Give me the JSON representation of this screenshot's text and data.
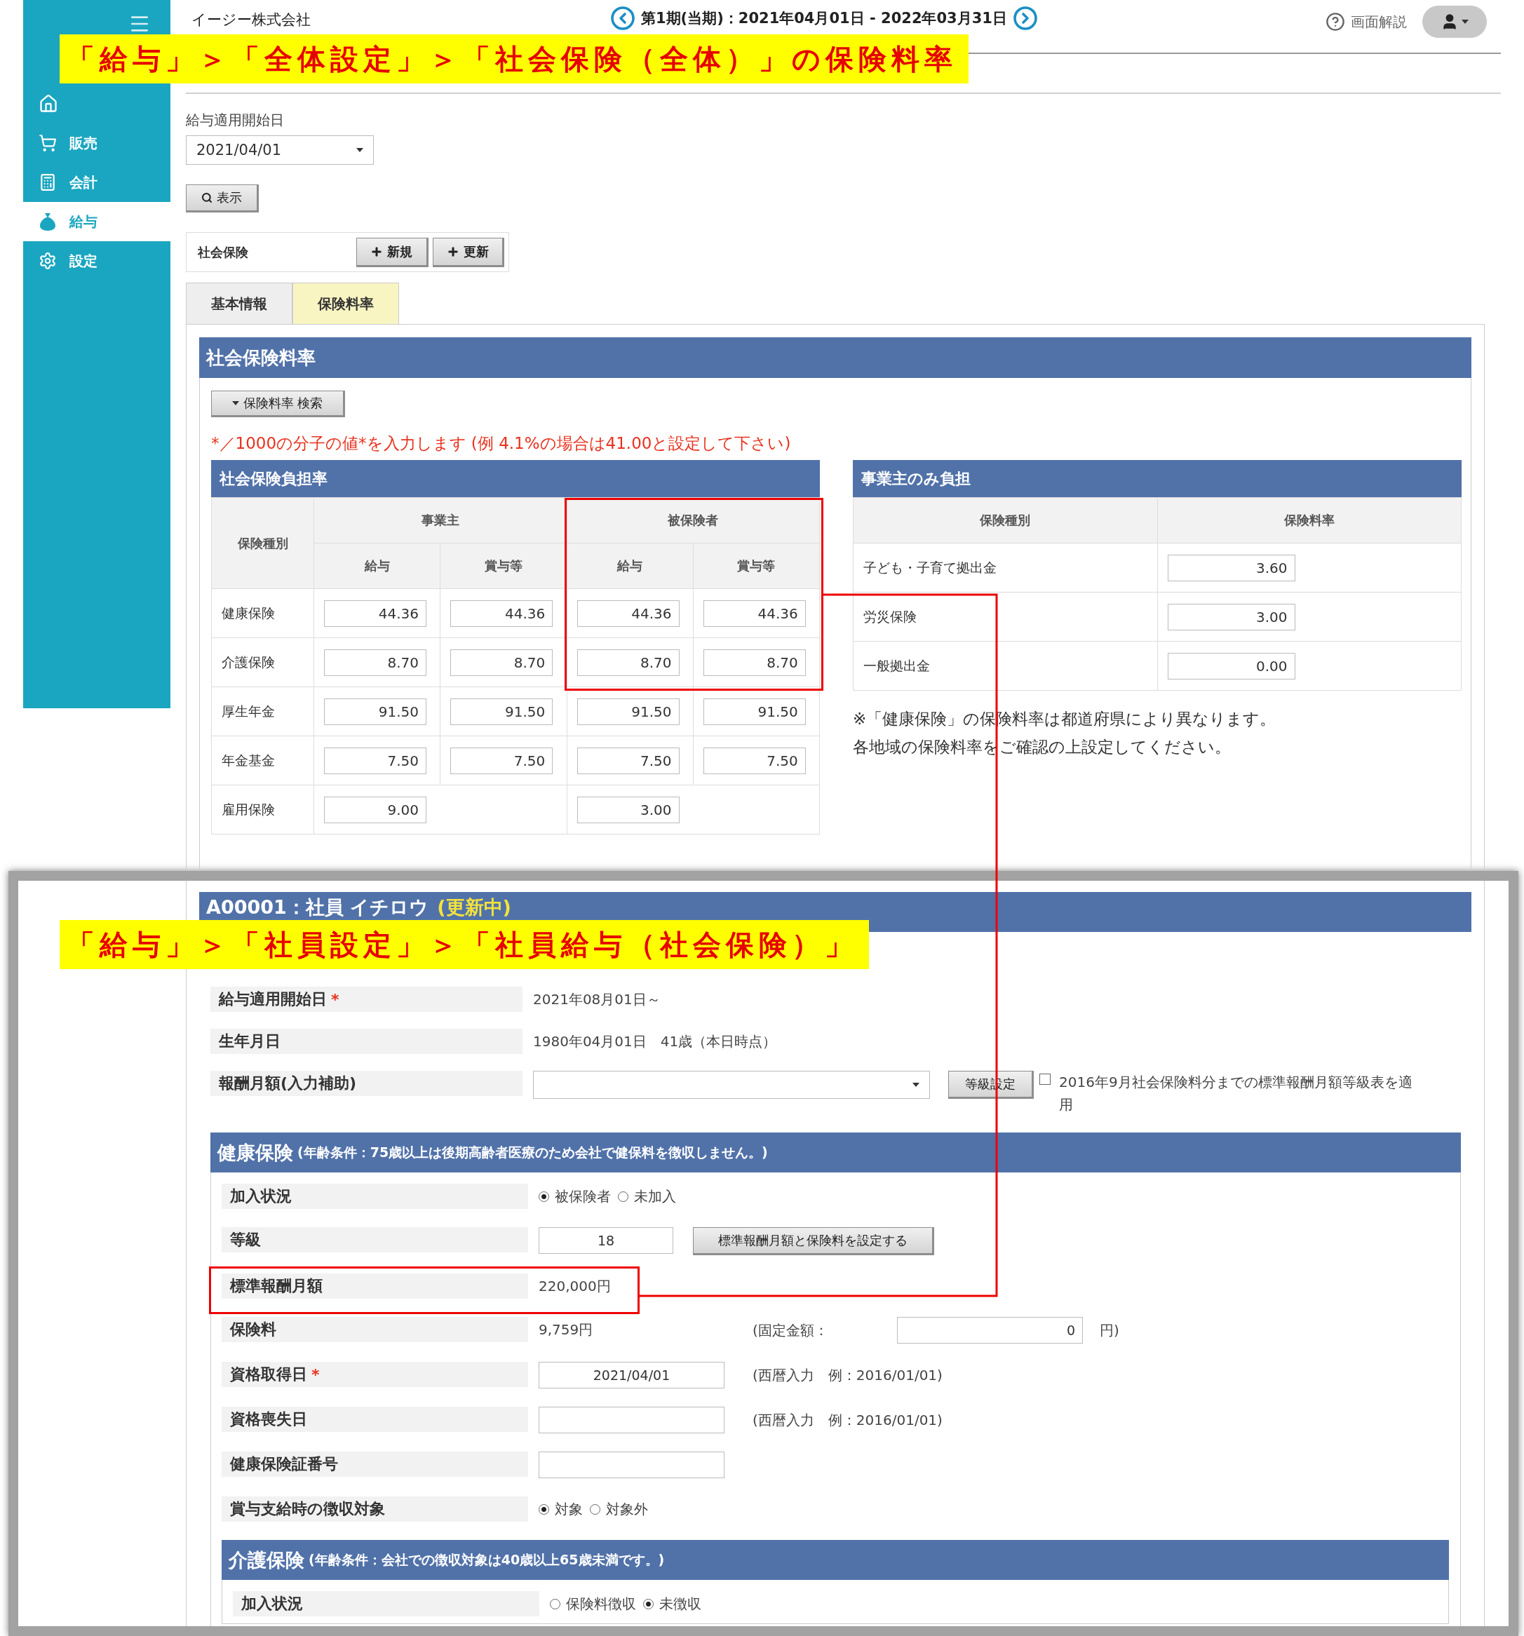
{
  "sidebar": {
    "items": [
      {
        "kind": "home",
        "selected": false
      },
      {
        "kind": "cart",
        "label": "販売",
        "selected": false
      },
      {
        "kind": "calculator",
        "label": "会計",
        "selected": false
      },
      {
        "kind": "moneybag",
        "label": "給与",
        "selected": true
      },
      {
        "kind": "gear",
        "label": "設定",
        "selected": false
      }
    ]
  },
  "header": {
    "company": "イージー株式会社",
    "period": "第1期(当期)：2021年04月01日 - 2022年03月31日",
    "help": "画面解説"
  },
  "filter": {
    "label": "給与適用開始日",
    "value": "2021/04/01",
    "button": "表示"
  },
  "insurance": {
    "label": "社会保険",
    "buttons": [
      "新規",
      "更新"
    ]
  },
  "tabs": [
    {
      "label": "基本情報",
      "selected": false
    },
    {
      "label": "保険料率",
      "selected": true
    }
  ],
  "rates": {
    "title": "社会保険料率",
    "search_button": "保険料率 検索",
    "note": "*／1000の分子の値*を入力します (例 4.1%の場合は41.00と設定して下さい)",
    "burden_table": {
      "title": "社会保険負担率",
      "type_header": "保険種別",
      "groups": [
        "事業主",
        "被保険者"
      ],
      "subheaders": [
        "給与",
        "賞与等",
        "給与",
        "賞与等"
      ],
      "rows": [
        {
          "kind": "split",
          "type": "健康保険",
          "values": [
            "44.36",
            "44.36",
            "44.36",
            "44.36"
          ]
        },
        {
          "kind": "split",
          "type": "介護保険",
          "values": [
            "8.70",
            "8.70",
            "8.70",
            "8.70"
          ]
        },
        {
          "kind": "split",
          "type": "厚生年金",
          "values": [
            "91.50",
            "91.50",
            "91.50",
            "91.50"
          ]
        },
        {
          "kind": "split",
          "type": "年金基金",
          "values": [
            "7.50",
            "7.50",
            "7.50",
            "7.50"
          ]
        },
        {
          "kind": "merged",
          "type": "雇用保険",
          "values": [
            "9.00",
            "3.00"
          ]
        }
      ]
    },
    "employer_table": {
      "title": "事業主のみ負担",
      "headers": [
        "保険種別",
        "保険料率"
      ],
      "rows": [
        {
          "type": "子ども・子育て拠出金",
          "value": "3.60"
        },
        {
          "type": "労災保険",
          "value": "3.00"
        },
        {
          "type": "一般拠出金",
          "value": "0.00"
        }
      ]
    },
    "footnote": [
      "※「健康保険」の保険料率は都道府県により異なります。",
      "各地域の保険料率をご確認の上設定してください。"
    ]
  },
  "employee": {
    "title": "A00001：社員 イチロウ",
    "status": "(更新中)",
    "rows": [
      {
        "kind": "text",
        "label": "給与適用開始日",
        "mark": "*",
        "value": "2021年08月01日～"
      },
      {
        "kind": "text",
        "label": "生年月日",
        "value": "1980年04月01日　41歳（本日時点）"
      },
      {
        "kind": "select",
        "label": "報酬月額(入力補助)",
        "button": "等級設定",
        "checkbox": {
          "checked": false,
          "label": "2016年9月社会保険料分までの標準報酬月額等級表を適用"
        }
      }
    ],
    "health": {
      "title": "健康保険",
      "condition": "(年齢条件：75歳以上は後期高齢者医療のため会社で健保料を徴収しません。)",
      "rows": [
        {
          "kind": "radio",
          "label": "加入状況",
          "options": [
            {
              "label": "被保険者",
              "selected": true
            },
            {
              "label": "未加入",
              "selected": false
            }
          ]
        },
        {
          "kind": "input",
          "label": "等級",
          "value": "18",
          "button": "標準報酬月額と保険料を設定する"
        },
        {
          "kind": "text",
          "label": "標準報酬月額",
          "value": "220,000円"
        },
        {
          "kind": "text",
          "label": "保険料",
          "value": "9,759円",
          "fixed": {
            "label": "(固定金額：",
            "value": "0",
            "suffix": "円)"
          }
        },
        {
          "kind": "date",
          "label": "資格取得日",
          "mark": "*",
          "value": "2021/04/01",
          "hint": "(西暦入力　例：2016/01/01)"
        },
        {
          "kind": "date",
          "label": "資格喪失日",
          "hint": "(西暦入力　例：2016/01/01)"
        },
        {
          "kind": "date",
          "label": "健康保険証番号"
        },
        {
          "kind": "radio",
          "label": "賞与支給時の徴収対象",
          "options": [
            {
              "label": "対象",
              "selected": true
            },
            {
              "label": "対象外",
              "selected": false
            }
          ]
        }
      ]
    },
    "care": {
      "title": "介護保険",
      "condition": "(年齢条件：会社での徴収対象は40歳以上65歳未満です。)",
      "rows": [
        {
          "kind": "radio",
          "label": "加入状況",
          "options": [
            {
              "label": "保険料徴収",
              "selected": false
            },
            {
              "label": "未徴収",
              "selected": true
            }
          ]
        }
      ]
    }
  },
  "annotations": [
    "「給与」＞「全体設定」＞「社会保険（全体）」の保険料率",
    "「給与」＞「社員設定」＞「社員給与（社会保険）」"
  ]
}
